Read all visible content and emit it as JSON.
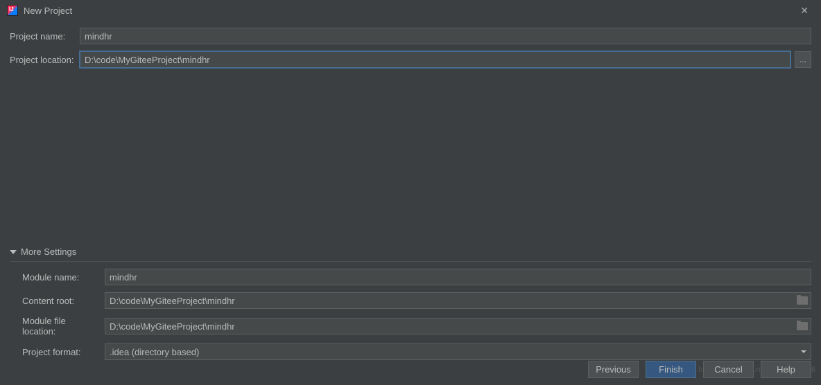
{
  "titlebar": {
    "title": "New Project"
  },
  "form": {
    "project_name_label": "Project name:",
    "project_name_value": "mindhr",
    "project_location_label": "Project location:",
    "project_location_value": "D:\\code\\MyGiteeProject\\mindhr",
    "browse_label": "..."
  },
  "more": {
    "header": "More Settings",
    "module_name_label": "Module name:",
    "module_name_value": "mindhr",
    "content_root_label": "Content root:",
    "content_root_value": "D:\\code\\MyGiteeProject\\mindhr",
    "module_file_label": "Module file location:",
    "module_file_value": "D:\\code\\MyGiteeProject\\mindhr",
    "project_format_label": "Project format:",
    "project_format_value": ".idea (directory based)"
  },
  "buttons": {
    "previous": "Previous",
    "finish": "Finish",
    "cancel": "Cancel",
    "help": "Help"
  },
  "watermark": "https://blog.csdn.net/qq_42700766"
}
